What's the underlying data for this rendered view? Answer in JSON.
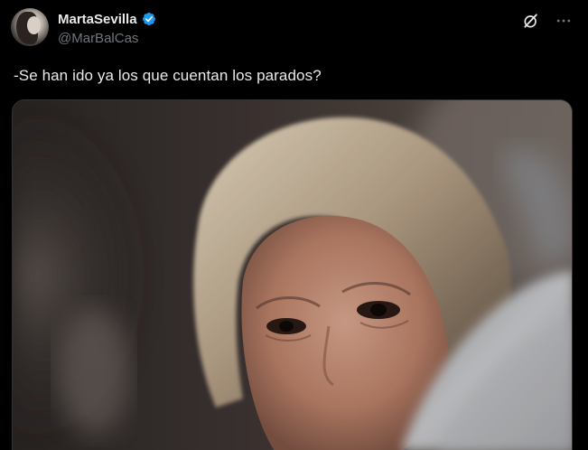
{
  "author": {
    "display_name": "MartaSevilla",
    "handle": "@MarBalCas",
    "verified": true,
    "avatar_icon": "profile-photo"
  },
  "actions": {
    "grok_icon": "grok-icon",
    "more_icon": "more-options-icon"
  },
  "tweet": {
    "text": "-Se han ido ya los que cuentan los parados?"
  },
  "media": {
    "type": "photo",
    "icon": "photo-image"
  },
  "colors": {
    "background": "#000000",
    "text_primary": "#e7e9ea",
    "text_secondary": "#71767b",
    "verified_blue": "#1d9bf0"
  }
}
